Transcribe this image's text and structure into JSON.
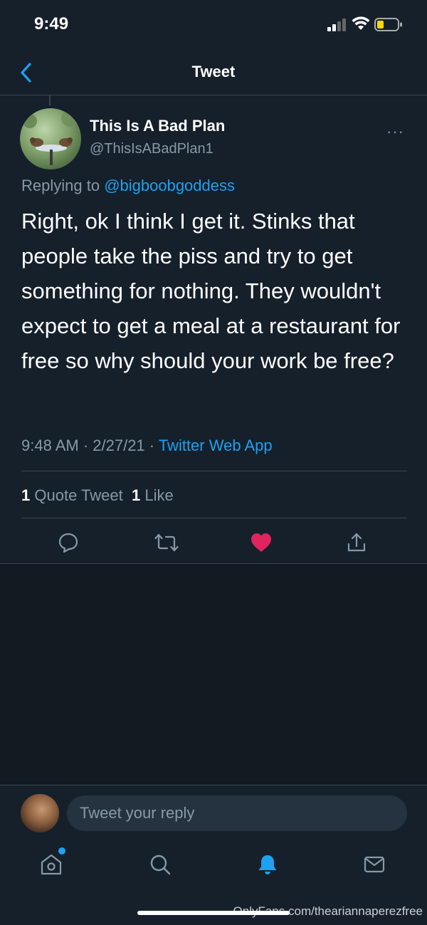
{
  "status_bar": {
    "time": "9:49"
  },
  "nav": {
    "title": "Tweet"
  },
  "tweet": {
    "display_name": "This Is A Bad Plan",
    "handle": "@ThisIsABadPlan1",
    "more": "···",
    "replying_prefix": "Replying to ",
    "replying_to": "@bigboobgoddess",
    "text": "Right, ok I think I get it. Stinks that people take the piss and try to get something for nothing. They wouldn't expect to get a meal at a restaurant for free so why should your work be free?",
    "time_date": "9:48 AM · 2/27/21 · ",
    "source": "Twitter Web App",
    "stats": {
      "quote_count": "1",
      "quote_label": "Quote Tweet",
      "like_count": "1",
      "like_label": "Like"
    },
    "actions": [
      "reply-icon",
      "retweet-icon",
      "like-icon-filled",
      "share-icon"
    ],
    "like_color": "#e0245e"
  },
  "reply": {
    "placeholder": "Tweet your reply"
  },
  "tab_bar": {
    "tabs": [
      "home-icon",
      "search-icon",
      "notifications-icon",
      "messages-icon"
    ],
    "active_color": "#1da1f2"
  },
  "watermark": "OnlyFans.com/theariannaperezfree",
  "colors": {
    "background": "#15202b",
    "accent": "#1da1f2",
    "muted": "#8899a6"
  }
}
